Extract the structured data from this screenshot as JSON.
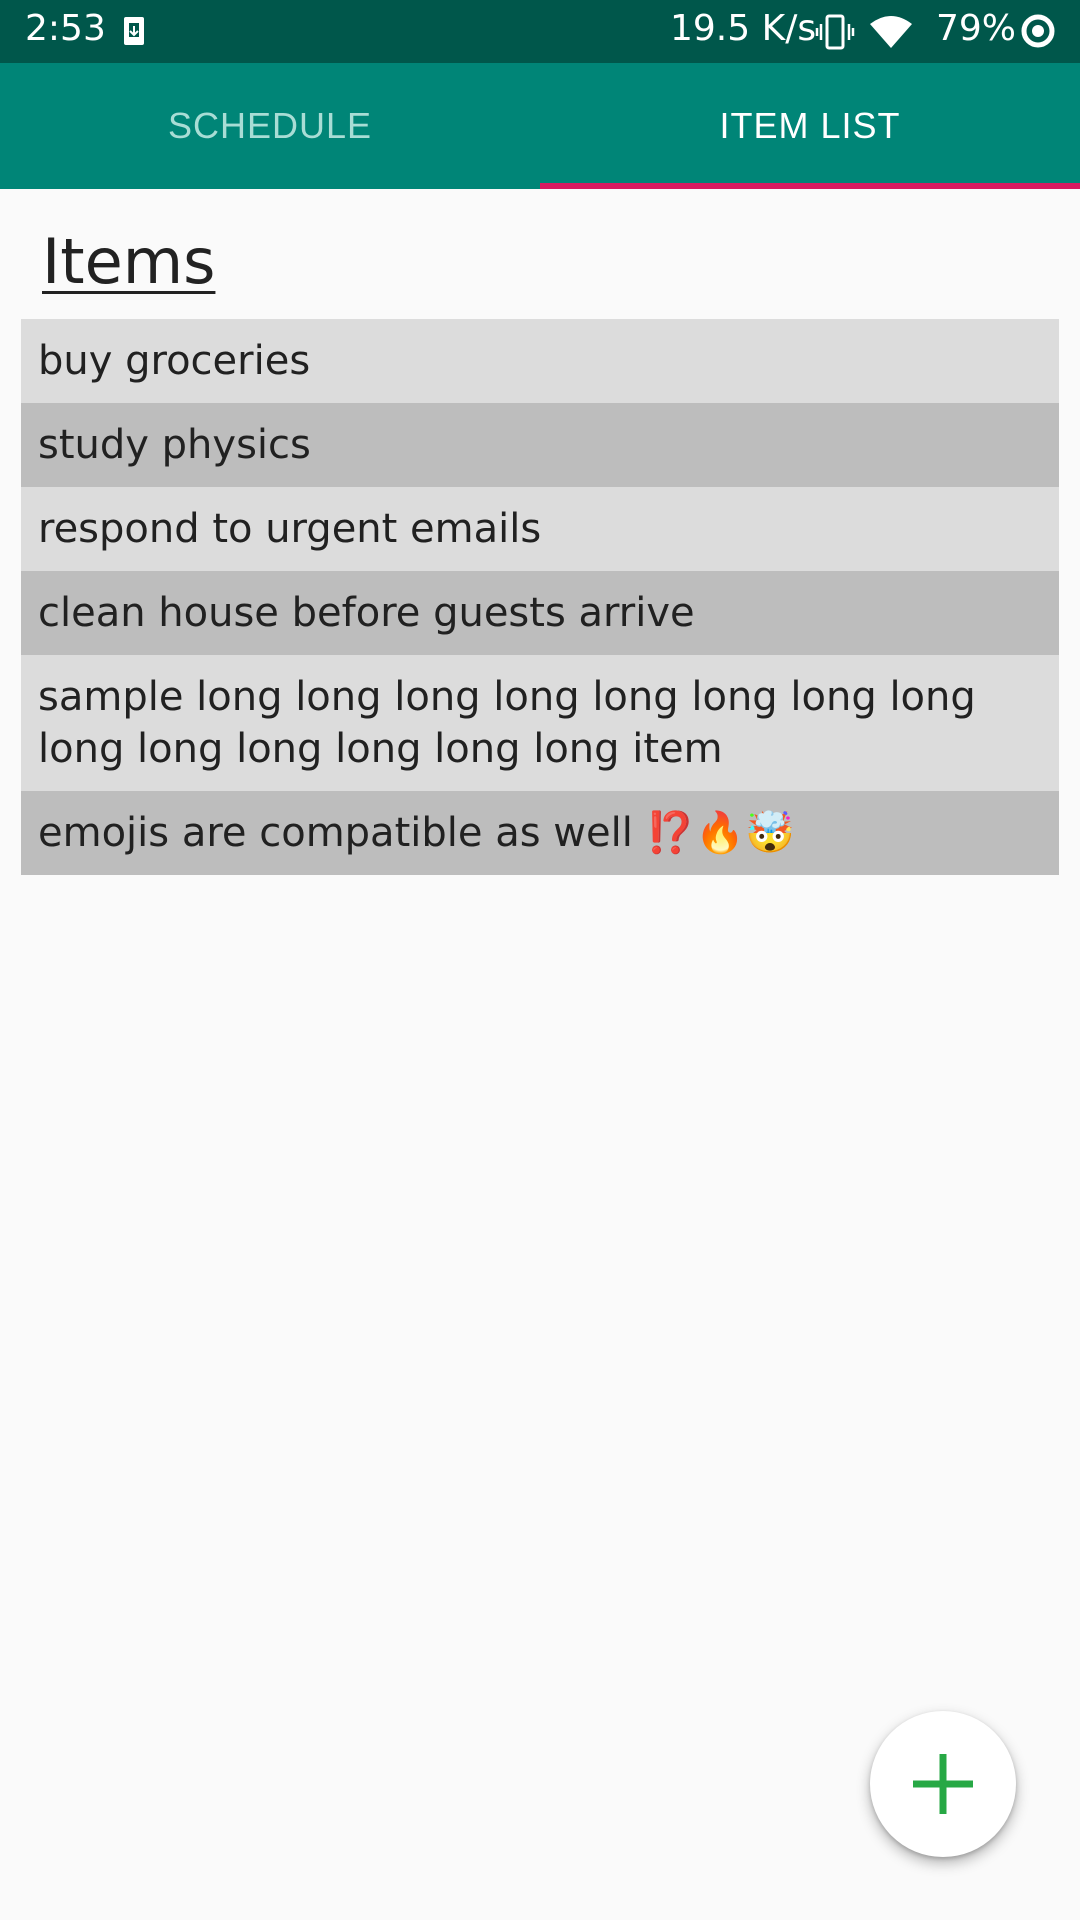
{
  "status_bar": {
    "time": "2:53",
    "net_speed": "19.5 K/s",
    "battery": "79%",
    "icons": [
      "download-icon",
      "vibrate-icon",
      "wifi-icon",
      "battery-saver-icon"
    ]
  },
  "tabs": [
    {
      "label": "SCHEDULE",
      "active": false
    },
    {
      "label": "ITEM LIST",
      "active": true
    }
  ],
  "page": {
    "title": "Items"
  },
  "items": [
    {
      "text": "buy groceries"
    },
    {
      "text": "study physics"
    },
    {
      "text": "respond to urgent emails"
    },
    {
      "text": "clean house before guests arrive"
    },
    {
      "text": "sample long long long long long long long long long long long long long long item"
    },
    {
      "text": "emojis are compatible as well ⁉️🔥🤯"
    }
  ],
  "fab": {
    "icon": "plus-icon"
  },
  "colors": {
    "status_bar": "#00574b",
    "toolbar": "#008577",
    "tab_indicator": "#d81b60",
    "fab_icon": "#27a845",
    "row_light": "#dcdcdc",
    "row_dark": "#bdbdbd"
  }
}
